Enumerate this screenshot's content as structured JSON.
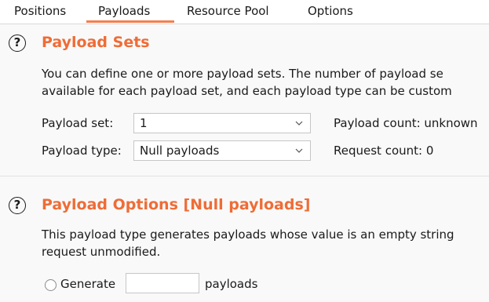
{
  "tabs": [
    {
      "label": "Positions"
    },
    {
      "label": "Payloads"
    },
    {
      "label": "Resource Pool"
    },
    {
      "label": "Options"
    }
  ],
  "payload_sets": {
    "help_icon_glyph": "?",
    "title": "Payload Sets",
    "description_line1": "You can define one or more payload sets. The number of payload se",
    "description_line2": "available for each payload set, and each payload type can be custom",
    "set_label": "Payload set:",
    "set_value": "1",
    "type_label": "Payload type:",
    "type_value": "Null payloads",
    "payload_count": "Payload count: unknown",
    "request_count": "Request count: 0"
  },
  "payload_options": {
    "help_icon_glyph": "?",
    "title": "Payload Options [Null payloads]",
    "description_line1": "This payload type generates payloads whose value is an empty string",
    "description_line2": "request unmodified.",
    "generate_label": "Generate",
    "generate_count_value": "",
    "payloads_suffix": "payloads"
  },
  "colors": {
    "accent": "#ef6c36",
    "tab_underline": "#f37f50",
    "panel_background": "#f9f9f9"
  },
  "icons": {
    "help": "question-circle-icon",
    "dropdown": "chevron-down-icon"
  }
}
